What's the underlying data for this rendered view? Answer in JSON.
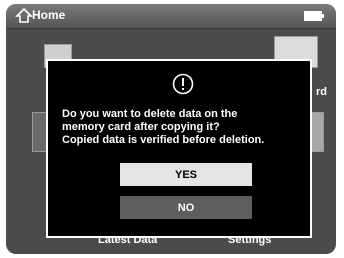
{
  "header": {
    "title": "Home",
    "home_icon": "home-icon",
    "battery_icon": "battery-icon"
  },
  "background": {
    "labels": [
      "Latest Data",
      "Settings"
    ],
    "partial_right_label": "rd"
  },
  "dialog": {
    "icon": "alert-icon",
    "message": "Do you want to delete data on the\nmemory card after copying it?\nCopied data is verified before deletion.",
    "yes_label": "YES",
    "no_label": "NO"
  },
  "colors": {
    "screen": "#4b4b4b",
    "dialog": "#000000",
    "yes_bg": "#e4e4e4",
    "no_bg": "#5e5e5e"
  }
}
